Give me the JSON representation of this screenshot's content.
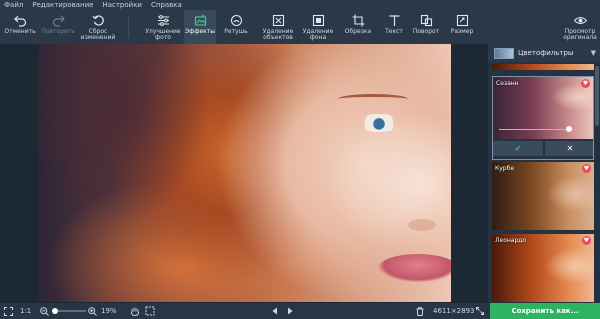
{
  "menu": [
    "Файл",
    "Редактирование",
    "Настройки",
    "Справка"
  ],
  "toolbar": {
    "undo": "Отменить",
    "redo": "Повторить",
    "reset_line1": "Сброс",
    "reset_line2": "изменений",
    "enhance_line1": "Улучшение",
    "enhance_line2": "фото",
    "effects": "Эффекты",
    "retouch": "Ретушь",
    "remove_objects_line1": "Удаление",
    "remove_objects_line2": "объектов",
    "remove_bg_line1": "Удаление",
    "remove_bg_line2": "фона",
    "crop": "Обрезка",
    "text": "Текст",
    "rotate": "Поворот",
    "resize": "Размер",
    "preview_line1": "Просмотр",
    "preview_line2": "оригинала"
  },
  "panel": {
    "category": "Цветофильтры",
    "filters": [
      {
        "label": "Сезанн",
        "favorite": true,
        "selected": true
      },
      {
        "label": "Курбе",
        "favorite": true,
        "selected": false
      },
      {
        "label": "Леонардо",
        "favorite": true,
        "selected": false
      }
    ],
    "intensity": 0.9,
    "apply_icon": "check-icon",
    "cancel_icon": "x-icon"
  },
  "status": {
    "ratio": "1:1",
    "zoom_percent": "19%",
    "zoom_level": 0.0,
    "dimensions": "4611×2893",
    "save_label": "Сохранить как..."
  },
  "colors": {
    "accent_green": "#2eb360",
    "toolbar_bg": "#2a3848",
    "favorite_red": "#e84b5a"
  }
}
